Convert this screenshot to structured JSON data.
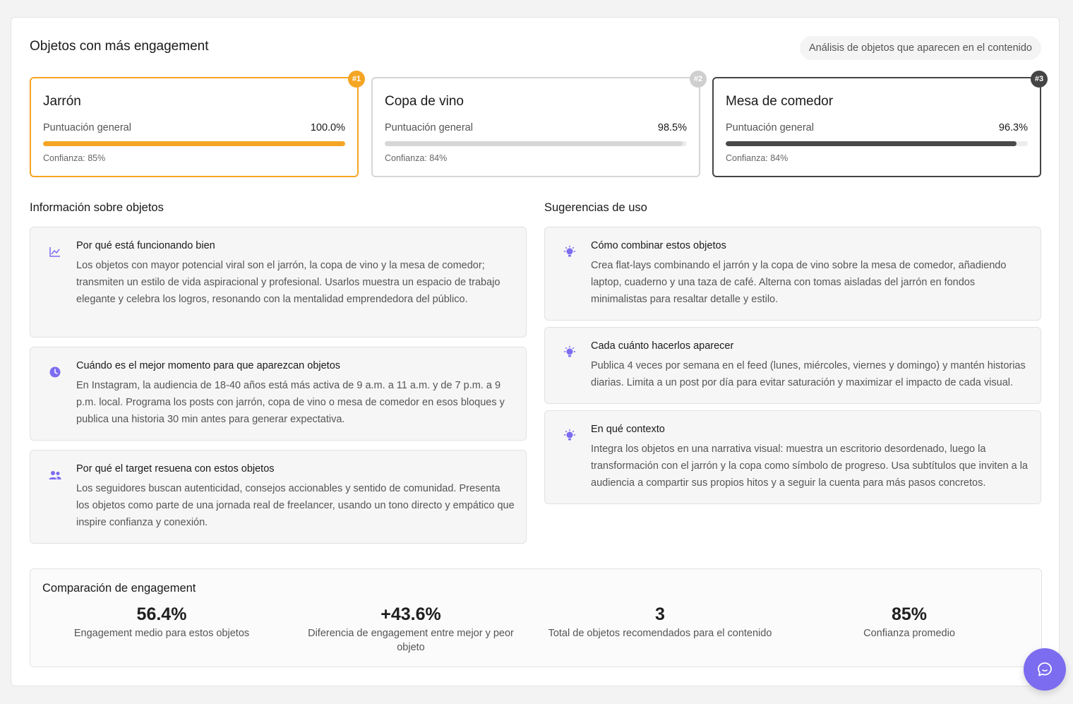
{
  "header": {
    "title": "Objetos con más engagement",
    "subtitle": "Análisis de objetos que aparecen en el contenido"
  },
  "ranking": [
    {
      "rank": "#1",
      "name": "Jarrón",
      "score_label": "Puntuación general",
      "score": "100.0%",
      "score_fraction": 1.0,
      "confidence": "Confianza: 85%"
    },
    {
      "rank": "#2",
      "name": "Copa de vino",
      "score_label": "Puntuación general",
      "score": "98.5%",
      "score_fraction": 0.985,
      "confidence": "Confianza: 84%"
    },
    {
      "rank": "#3",
      "name": "Mesa de comedor",
      "score_label": "Puntuación general",
      "score": "96.3%",
      "score_fraction": 0.963,
      "confidence": "Confianza: 84%"
    }
  ],
  "info": {
    "heading": "Información sobre objetos",
    "cards": [
      {
        "icon": "trend-chart-icon",
        "title": "Por qué está funcionando bien",
        "body": "Los objetos con mayor potencial viral son el jarrón, la copa de vino y la mesa de comedor; transmiten un estilo de vida aspiracional y profesional. Usarlos muestra un espacio de trabajo elegante y celebra los logros, resonando con la mentalidad emprendedora del público."
      },
      {
        "icon": "clock-icon",
        "title": "Cuándo es el mejor momento para que aparezcan objetos",
        "body": "En Instagram, la audiencia de 18-40 años está más activa de 9 a.m. a 11 a.m. y de 7 p.m. a 9 p.m. local. Programa los posts con jarrón, copa de vino o mesa de comedor en esos bloques y publica una historia 30 min antes para generar expectativa."
      },
      {
        "icon": "people-icon",
        "title": "Por qué el target resuena con estos objetos",
        "body": "Los seguidores buscan autenticidad, consejos accionables y sentido de comunidad. Presenta los objetos como parte de una jornada real de freelancer, usando un tono directo y empático que inspire confianza y conexión."
      }
    ]
  },
  "suggestions": {
    "heading": "Sugerencias de uso",
    "cards": [
      {
        "icon": "lightbulb-icon",
        "title": "Cómo combinar estos objetos",
        "body": "Crea flat-lays combinando el jarrón y la copa de vino sobre la mesa de comedor, añadiendo laptop, cuaderno y una taza de café. Alterna con tomas aisladas del jarrón en fondos minimalistas para resaltar detalle y estilo."
      },
      {
        "icon": "lightbulb-icon",
        "title": "Cada cuánto hacerlos aparecer",
        "body": "Publica 4 veces por semana en el feed (lunes, miércoles, viernes y domingo) y mantén historias diarias. Limita a un post por día para evitar saturación y maximizar el impacto de cada visual."
      },
      {
        "icon": "lightbulb-icon",
        "title": "En qué contexto",
        "body": "Integra los objetos en una narrativa visual: muestra un escritorio desordenado, luego la transformación con el jarrón y la copa como símbolo de progreso. Usa subtítulos que inviten a la audiencia a compartir sus propios hitos y a seguir la cuenta para más pasos concretos."
      }
    ]
  },
  "comparison": {
    "title": "Comparación de engagement",
    "stats": [
      {
        "value": "56.4%",
        "label": "Engagement medio para estos objetos"
      },
      {
        "value": "+43.6%",
        "label": "Diferencia de engagement entre mejor y peor objeto"
      },
      {
        "value": "3",
        "label": "Total de objetos recomendados para el contenido"
      },
      {
        "value": "85%",
        "label": "Confianza promedio"
      }
    ]
  },
  "fab": {
    "icon": "chat-icon"
  },
  "colors": {
    "rank1": "#f5a524",
    "rank2": "#d6d6d6",
    "rank3": "#444444",
    "accent": "#7c6cf0"
  }
}
